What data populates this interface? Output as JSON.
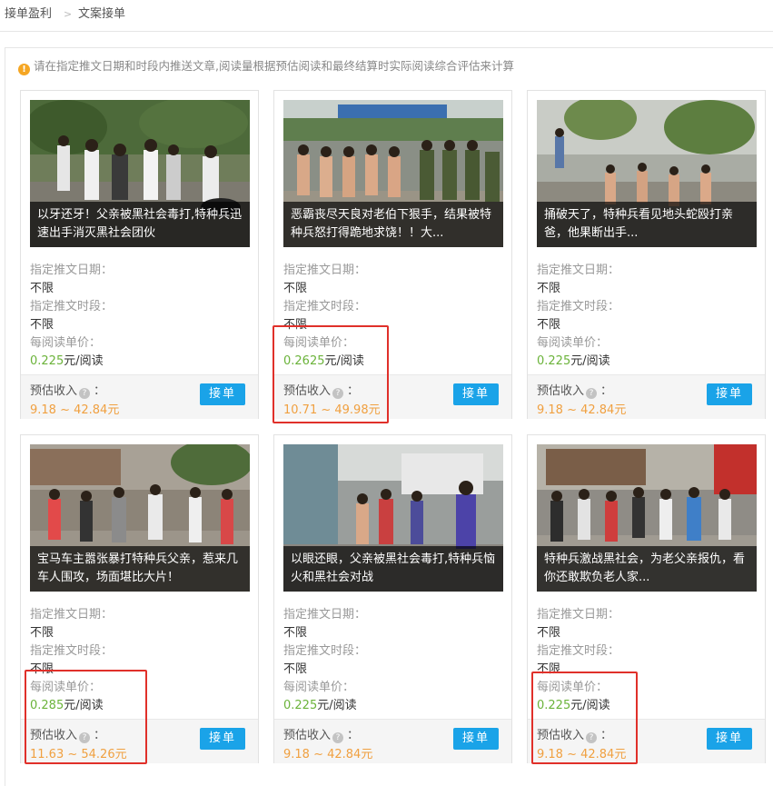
{
  "breadcrumb": {
    "parent": "接单盈利",
    "separator": ">",
    "current": "文案接单"
  },
  "notice": {
    "text": "请在指定推文日期和时段内推送文章,阅读量根据预估阅读和最终结算时实际阅读综合评估来计算"
  },
  "labels": {
    "date": "指定推文日期：",
    "period": "指定推文时段：",
    "unit_price": "每阅读单价：",
    "estimate": "预估收入",
    "help_glyph": "?",
    "colon": "：",
    "accept": "接单"
  },
  "cards": [
    {
      "title": "以牙还牙！父亲被黑社会毒打,特种兵迅速出手消灭黑社会团伙",
      "date": "不限",
      "period": "不限",
      "price": "0.225",
      "price_unit": "元/阅读",
      "estimate": "9.18 ~ 42.84元"
    },
    {
      "title": "恶霸丧尽天良对老伯下狠手，结果被特种兵怒打得跪地求饶！！大...",
      "date": "不限",
      "period": "不限",
      "price": "0.2625",
      "price_unit": "元/阅读",
      "estimate": "10.71 ~ 49.98元"
    },
    {
      "title": "捅破天了，特种兵看见地头蛇殴打亲爸，他果断出手...",
      "date": "不限",
      "period": "不限",
      "price": "0.225",
      "price_unit": "元/阅读",
      "estimate": "9.18 ~ 42.84元"
    },
    {
      "title": "宝马车主嚣张暴打特种兵父亲，惹来几车人围攻，场面堪比大片！",
      "date": "不限",
      "period": "不限",
      "price": "0.285",
      "price_unit": "元/阅读",
      "estimate": "11.63 ~ 54.26元"
    },
    {
      "title": "以眼还眼，父亲被黑社会毒打,特种兵恼火和黑社会对战",
      "date": "不限",
      "period": "不限",
      "price": "0.225",
      "price_unit": "元/阅读",
      "estimate": "9.18 ~ 42.84元"
    },
    {
      "title": "特种兵激战黑社会，为老父亲报仇，看你还敢欺负老人家...",
      "date": "不限",
      "period": "不限",
      "price": "0.225",
      "price_unit": "元/阅读",
      "estimate": "9.18 ~ 42.84元"
    }
  ],
  "colors": {
    "accent": "#1aa3e8",
    "price": "#6bb33a",
    "estimate": "#f0a040",
    "highlight": "#e0302a"
  }
}
